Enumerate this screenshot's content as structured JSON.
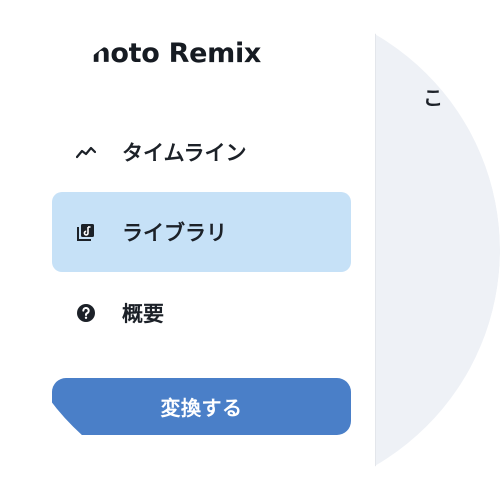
{
  "app": {
    "brand_title": "Photo Remix"
  },
  "sidebar": {
    "items": [
      {
        "label": "タイムライン",
        "icon": "trend-line-icon",
        "active": false
      },
      {
        "label": "ライブラリ",
        "icon": "library-icon",
        "active": true
      },
      {
        "label": "概要",
        "icon": "help-circle-icon",
        "active": false
      }
    ],
    "convert_label": "変換する"
  },
  "main": {
    "partial_heading": "こ"
  },
  "colors": {
    "active_item_bg": "#c6e1f7",
    "primary_button": "#4a7fc8",
    "main_bg": "#eef1f6"
  }
}
